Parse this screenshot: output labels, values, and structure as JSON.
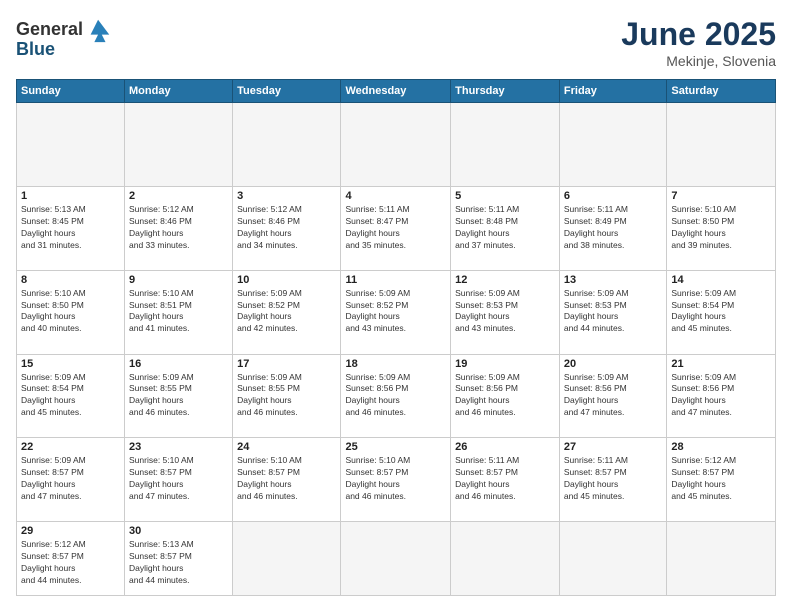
{
  "header": {
    "logo_general": "General",
    "logo_blue": "Blue",
    "title": "June 2025",
    "location": "Mekinje, Slovenia"
  },
  "calendar": {
    "days_of_week": [
      "Sunday",
      "Monday",
      "Tuesday",
      "Wednesday",
      "Thursday",
      "Friday",
      "Saturday"
    ],
    "weeks": [
      [
        {
          "day": "",
          "empty": true
        },
        {
          "day": "",
          "empty": true
        },
        {
          "day": "",
          "empty": true
        },
        {
          "day": "",
          "empty": true
        },
        {
          "day": "",
          "empty": true
        },
        {
          "day": "",
          "empty": true
        },
        {
          "day": "",
          "empty": true
        }
      ],
      [
        {
          "day": "1",
          "sunrise": "5:13 AM",
          "sunset": "8:45 PM",
          "daylight": "15 hours and 31 minutes."
        },
        {
          "day": "2",
          "sunrise": "5:12 AM",
          "sunset": "8:46 PM",
          "daylight": "15 hours and 33 minutes."
        },
        {
          "day": "3",
          "sunrise": "5:12 AM",
          "sunset": "8:46 PM",
          "daylight": "15 hours and 34 minutes."
        },
        {
          "day": "4",
          "sunrise": "5:11 AM",
          "sunset": "8:47 PM",
          "daylight": "15 hours and 35 minutes."
        },
        {
          "day": "5",
          "sunrise": "5:11 AM",
          "sunset": "8:48 PM",
          "daylight": "15 hours and 37 minutes."
        },
        {
          "day": "6",
          "sunrise": "5:11 AM",
          "sunset": "8:49 PM",
          "daylight": "15 hours and 38 minutes."
        },
        {
          "day": "7",
          "sunrise": "5:10 AM",
          "sunset": "8:50 PM",
          "daylight": "15 hours and 39 minutes."
        }
      ],
      [
        {
          "day": "8",
          "sunrise": "5:10 AM",
          "sunset": "8:50 PM",
          "daylight": "15 hours and 40 minutes."
        },
        {
          "day": "9",
          "sunrise": "5:10 AM",
          "sunset": "8:51 PM",
          "daylight": "15 hours and 41 minutes."
        },
        {
          "day": "10",
          "sunrise": "5:09 AM",
          "sunset": "8:52 PM",
          "daylight": "15 hours and 42 minutes."
        },
        {
          "day": "11",
          "sunrise": "5:09 AM",
          "sunset": "8:52 PM",
          "daylight": "15 hours and 43 minutes."
        },
        {
          "day": "12",
          "sunrise": "5:09 AM",
          "sunset": "8:53 PM",
          "daylight": "15 hours and 43 minutes."
        },
        {
          "day": "13",
          "sunrise": "5:09 AM",
          "sunset": "8:53 PM",
          "daylight": "15 hours and 44 minutes."
        },
        {
          "day": "14",
          "sunrise": "5:09 AM",
          "sunset": "8:54 PM",
          "daylight": "15 hours and 45 minutes."
        }
      ],
      [
        {
          "day": "15",
          "sunrise": "5:09 AM",
          "sunset": "8:54 PM",
          "daylight": "15 hours and 45 minutes."
        },
        {
          "day": "16",
          "sunrise": "5:09 AM",
          "sunset": "8:55 PM",
          "daylight": "15 hours and 46 minutes."
        },
        {
          "day": "17",
          "sunrise": "5:09 AM",
          "sunset": "8:55 PM",
          "daylight": "15 hours and 46 minutes."
        },
        {
          "day": "18",
          "sunrise": "5:09 AM",
          "sunset": "8:56 PM",
          "daylight": "15 hours and 46 minutes."
        },
        {
          "day": "19",
          "sunrise": "5:09 AM",
          "sunset": "8:56 PM",
          "daylight": "15 hours and 46 minutes."
        },
        {
          "day": "20",
          "sunrise": "5:09 AM",
          "sunset": "8:56 PM",
          "daylight": "15 hours and 47 minutes."
        },
        {
          "day": "21",
          "sunrise": "5:09 AM",
          "sunset": "8:56 PM",
          "daylight": "15 hours and 47 minutes."
        }
      ],
      [
        {
          "day": "22",
          "sunrise": "5:09 AM",
          "sunset": "8:57 PM",
          "daylight": "15 hours and 47 minutes."
        },
        {
          "day": "23",
          "sunrise": "5:10 AM",
          "sunset": "8:57 PM",
          "daylight": "15 hours and 47 minutes."
        },
        {
          "day": "24",
          "sunrise": "5:10 AM",
          "sunset": "8:57 PM",
          "daylight": "15 hours and 46 minutes."
        },
        {
          "day": "25",
          "sunrise": "5:10 AM",
          "sunset": "8:57 PM",
          "daylight": "15 hours and 46 minutes."
        },
        {
          "day": "26",
          "sunrise": "5:11 AM",
          "sunset": "8:57 PM",
          "daylight": "15 hours and 46 minutes."
        },
        {
          "day": "27",
          "sunrise": "5:11 AM",
          "sunset": "8:57 PM",
          "daylight": "15 hours and 45 minutes."
        },
        {
          "day": "28",
          "sunrise": "5:12 AM",
          "sunset": "8:57 PM",
          "daylight": "15 hours and 45 minutes."
        }
      ],
      [
        {
          "day": "29",
          "sunrise": "5:12 AM",
          "sunset": "8:57 PM",
          "daylight": "15 hours and 44 minutes."
        },
        {
          "day": "30",
          "sunrise": "5:13 AM",
          "sunset": "8:57 PM",
          "daylight": "15 hours and 44 minutes."
        },
        {
          "day": "",
          "empty": true
        },
        {
          "day": "",
          "empty": true
        },
        {
          "day": "",
          "empty": true
        },
        {
          "day": "",
          "empty": true
        },
        {
          "day": "",
          "empty": true
        }
      ]
    ]
  }
}
